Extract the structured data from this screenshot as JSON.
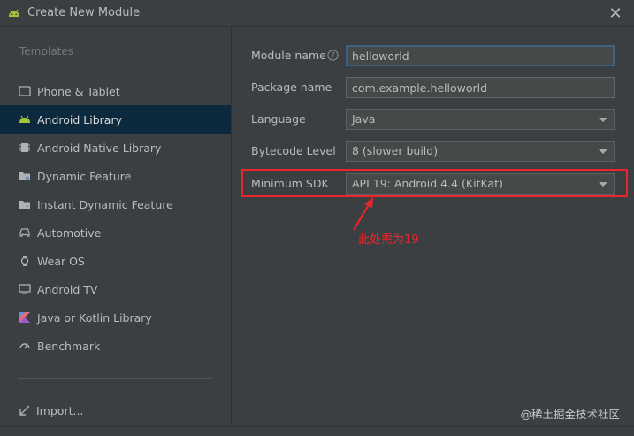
{
  "window": {
    "title": "Create New Module",
    "close_icon": "close-icon"
  },
  "sidebar": {
    "header": "Templates",
    "items": [
      {
        "label": "Phone & Tablet",
        "icon": "phone-icon",
        "selected": false
      },
      {
        "label": "Android Library",
        "icon": "android-icon",
        "selected": true
      },
      {
        "label": "Android Native Library",
        "icon": "native-library-icon",
        "selected": false
      },
      {
        "label": "Dynamic Feature",
        "icon": "folder-icon",
        "selected": false
      },
      {
        "label": "Instant Dynamic Feature",
        "icon": "instant-folder-icon",
        "selected": false
      },
      {
        "label": "Automotive",
        "icon": "car-icon",
        "selected": false
      },
      {
        "label": "Wear OS",
        "icon": "watch-icon",
        "selected": false
      },
      {
        "label": "Android TV",
        "icon": "tv-icon",
        "selected": false
      },
      {
        "label": "Java or Kotlin Library",
        "icon": "kotlin-icon",
        "selected": false
      },
      {
        "label": "Benchmark",
        "icon": "benchmark-icon",
        "selected": false
      }
    ],
    "import_label": "Import..."
  },
  "form": {
    "module_name": {
      "label": "Module name",
      "value": "helloworld"
    },
    "package_name": {
      "label": "Package name",
      "value": "com.example.helloworld"
    },
    "language": {
      "label": "Language",
      "value": "Java"
    },
    "bytecode_level": {
      "label": "Bytecode Level",
      "value": "8 (slower build)"
    },
    "minimum_sdk": {
      "label": "Minimum SDK",
      "value": "API 19: Android 4.4 (KitKat)"
    }
  },
  "annotation": {
    "text": "此处需为19",
    "color": "#e8262b"
  },
  "watermark": "@稀土掘金技术社区",
  "colors": {
    "background": "#3c3f41",
    "selected": "#0d293e",
    "field": "#45494a",
    "accent": "#3d6185"
  }
}
